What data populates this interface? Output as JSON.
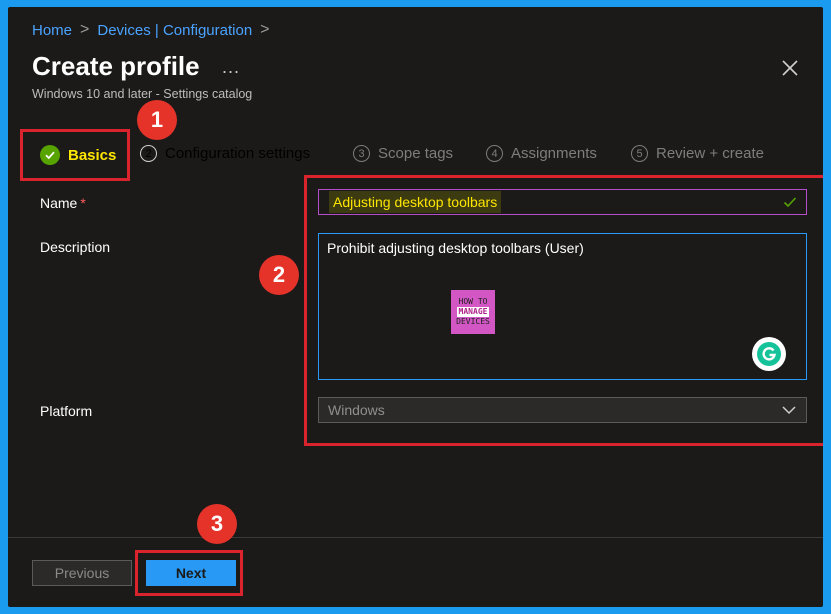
{
  "breadcrumb": {
    "items": [
      "Home",
      "Devices | Configuration"
    ],
    "separator": ">"
  },
  "header": {
    "title": "Create profile",
    "more_label": "...",
    "subtitle": "Windows 10 and later - Settings catalog"
  },
  "tabs": [
    {
      "step": "",
      "label": "Basics",
      "state": "active"
    },
    {
      "step": "2",
      "label": "Configuration settings",
      "state": "upcoming"
    },
    {
      "step": "3",
      "label": "Scope tags",
      "state": "disabled"
    },
    {
      "step": "4",
      "label": "Assignments",
      "state": "disabled"
    },
    {
      "step": "5",
      "label": "Review + create",
      "state": "disabled"
    }
  ],
  "form": {
    "name_label": "Name",
    "name_required_mark": "*",
    "name_value": "Adjusting desktop toolbars",
    "description_label": "Description",
    "description_value": "Prohibit adjusting desktop toolbars (User)",
    "platform_label": "Platform",
    "platform_value": "Windows"
  },
  "watermark": {
    "line1": "HOW TO",
    "line2": "MANAGE",
    "line3": "DEVICES"
  },
  "footer": {
    "previous_label": "Previous",
    "next_label": "Next"
  },
  "callouts": [
    "1",
    "2",
    "3"
  ],
  "colors": {
    "accent": "#2899f5",
    "highlight_red": "#d9232d",
    "success_green": "#57a300",
    "highlight_text": "#ffe600"
  }
}
